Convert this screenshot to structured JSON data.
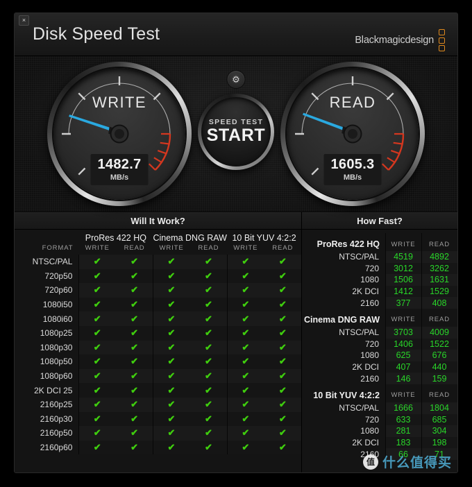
{
  "window": {
    "title": "Disk Speed Test",
    "close_label": "×",
    "brand_text": "Blackmagicdesign"
  },
  "colors": {
    "accent_blue": "#2aa9e0",
    "check_green": "#3fcd0e",
    "value_green": "#29d629",
    "brand_orange": "#e08a1e",
    "red_zone": "#d4371f"
  },
  "gauges": {
    "write": {
      "label": "WRITE",
      "value": "1482.7",
      "unit": "MB/s",
      "needle_deg": 200
    },
    "read": {
      "label": "READ",
      "value": "1605.3",
      "unit": "MB/s",
      "needle_deg": 202
    }
  },
  "start_button": {
    "top_label": "SPEED TEST",
    "main_label": "START"
  },
  "gear_button": {
    "icon": "gear-icon",
    "glyph": "⚙"
  },
  "will_it_work": {
    "title": "Will It Work?",
    "format_header": "FORMAT",
    "groups": [
      {
        "name": "ProRes 422 HQ",
        "columns": [
          "WRITE",
          "READ"
        ]
      },
      {
        "name": "Cinema DNG RAW",
        "columns": [
          "WRITE",
          "READ"
        ]
      },
      {
        "name": "10 Bit YUV 4:2:2",
        "columns": [
          "WRITE",
          "READ"
        ]
      }
    ],
    "check_glyph": "✔",
    "rows": [
      {
        "format": "NTSC/PAL",
        "cells": [
          true,
          true,
          true,
          true,
          true,
          true
        ]
      },
      {
        "format": "720p50",
        "cells": [
          true,
          true,
          true,
          true,
          true,
          true
        ]
      },
      {
        "format": "720p60",
        "cells": [
          true,
          true,
          true,
          true,
          true,
          true
        ]
      },
      {
        "format": "1080i50",
        "cells": [
          true,
          true,
          true,
          true,
          true,
          true
        ]
      },
      {
        "format": "1080i60",
        "cells": [
          true,
          true,
          true,
          true,
          true,
          true
        ]
      },
      {
        "format": "1080p25",
        "cells": [
          true,
          true,
          true,
          true,
          true,
          true
        ]
      },
      {
        "format": "1080p30",
        "cells": [
          true,
          true,
          true,
          true,
          true,
          true
        ]
      },
      {
        "format": "1080p50",
        "cells": [
          true,
          true,
          true,
          true,
          true,
          true
        ]
      },
      {
        "format": "1080p60",
        "cells": [
          true,
          true,
          true,
          true,
          true,
          true
        ]
      },
      {
        "format": "2K DCI 25",
        "cells": [
          true,
          true,
          true,
          true,
          true,
          true
        ]
      },
      {
        "format": "2160p25",
        "cells": [
          true,
          true,
          true,
          true,
          true,
          true
        ]
      },
      {
        "format": "2160p30",
        "cells": [
          true,
          true,
          true,
          true,
          true,
          true
        ]
      },
      {
        "format": "2160p50",
        "cells": [
          true,
          true,
          true,
          true,
          true,
          true
        ]
      },
      {
        "format": "2160p60",
        "cells": [
          true,
          true,
          true,
          true,
          true,
          true
        ]
      }
    ]
  },
  "how_fast": {
    "title": "How Fast?",
    "groups": [
      {
        "name": "ProRes 422 HQ",
        "columns": [
          "WRITE",
          "READ"
        ],
        "rows": [
          {
            "format": "NTSC/PAL",
            "write": "4519",
            "read": "4892"
          },
          {
            "format": "720",
            "write": "3012",
            "read": "3262"
          },
          {
            "format": "1080",
            "write": "1506",
            "read": "1631"
          },
          {
            "format": "2K DCI",
            "write": "1412",
            "read": "1529"
          },
          {
            "format": "2160",
            "write": "377",
            "read": "408"
          }
        ]
      },
      {
        "name": "Cinema DNG RAW",
        "columns": [
          "WRITE",
          "READ"
        ],
        "rows": [
          {
            "format": "NTSC/PAL",
            "write": "3703",
            "read": "4009"
          },
          {
            "format": "720",
            "write": "1406",
            "read": "1522"
          },
          {
            "format": "1080",
            "write": "625",
            "read": "676"
          },
          {
            "format": "2K DCI",
            "write": "407",
            "read": "440"
          },
          {
            "format": "2160",
            "write": "146",
            "read": "159"
          }
        ]
      },
      {
        "name": "10 Bit YUV 4:2:2",
        "columns": [
          "WRITE",
          "READ"
        ],
        "rows": [
          {
            "format": "NTSC/PAL",
            "write": "1666",
            "read": "1804"
          },
          {
            "format": "720",
            "write": "633",
            "read": "685"
          },
          {
            "format": "1080",
            "write": "281",
            "read": "304"
          },
          {
            "format": "2K DCI",
            "write": "183",
            "read": "198"
          },
          {
            "format": "2160",
            "write": "66",
            "read": "71"
          }
        ]
      }
    ]
  },
  "watermark": {
    "logo_char": "值",
    "text": "什么值得买"
  }
}
